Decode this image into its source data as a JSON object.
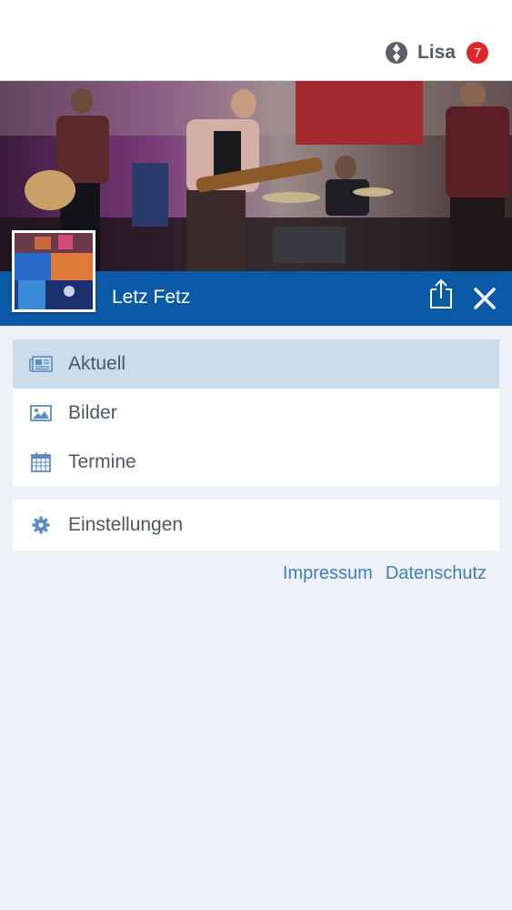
{
  "header": {
    "user_name": "Lisa",
    "notification_count": "7",
    "logo_icon": "app-logo-icon"
  },
  "hero": {
    "image_description_icon": "band-photo"
  },
  "group": {
    "title": "Letz Fetz",
    "share_icon": "share-icon",
    "close_icon": "close-icon"
  },
  "menu": {
    "items": [
      {
        "label": "Aktuell",
        "icon": "newspaper-icon",
        "active": true
      },
      {
        "label": "Bilder",
        "icon": "image-icon",
        "active": false
      },
      {
        "label": "Termine",
        "icon": "calendar-icon",
        "active": false
      }
    ],
    "settings": {
      "label": "Einstellungen",
      "icon": "gear-icon"
    }
  },
  "footer": {
    "impressum": "Impressum",
    "datenschutz": "Datenschutz"
  },
  "colors": {
    "brand_blue": "#0b5aa8",
    "active_row": "#cbdcea",
    "link": "#3d7fb8",
    "badge": "#e0262d"
  }
}
